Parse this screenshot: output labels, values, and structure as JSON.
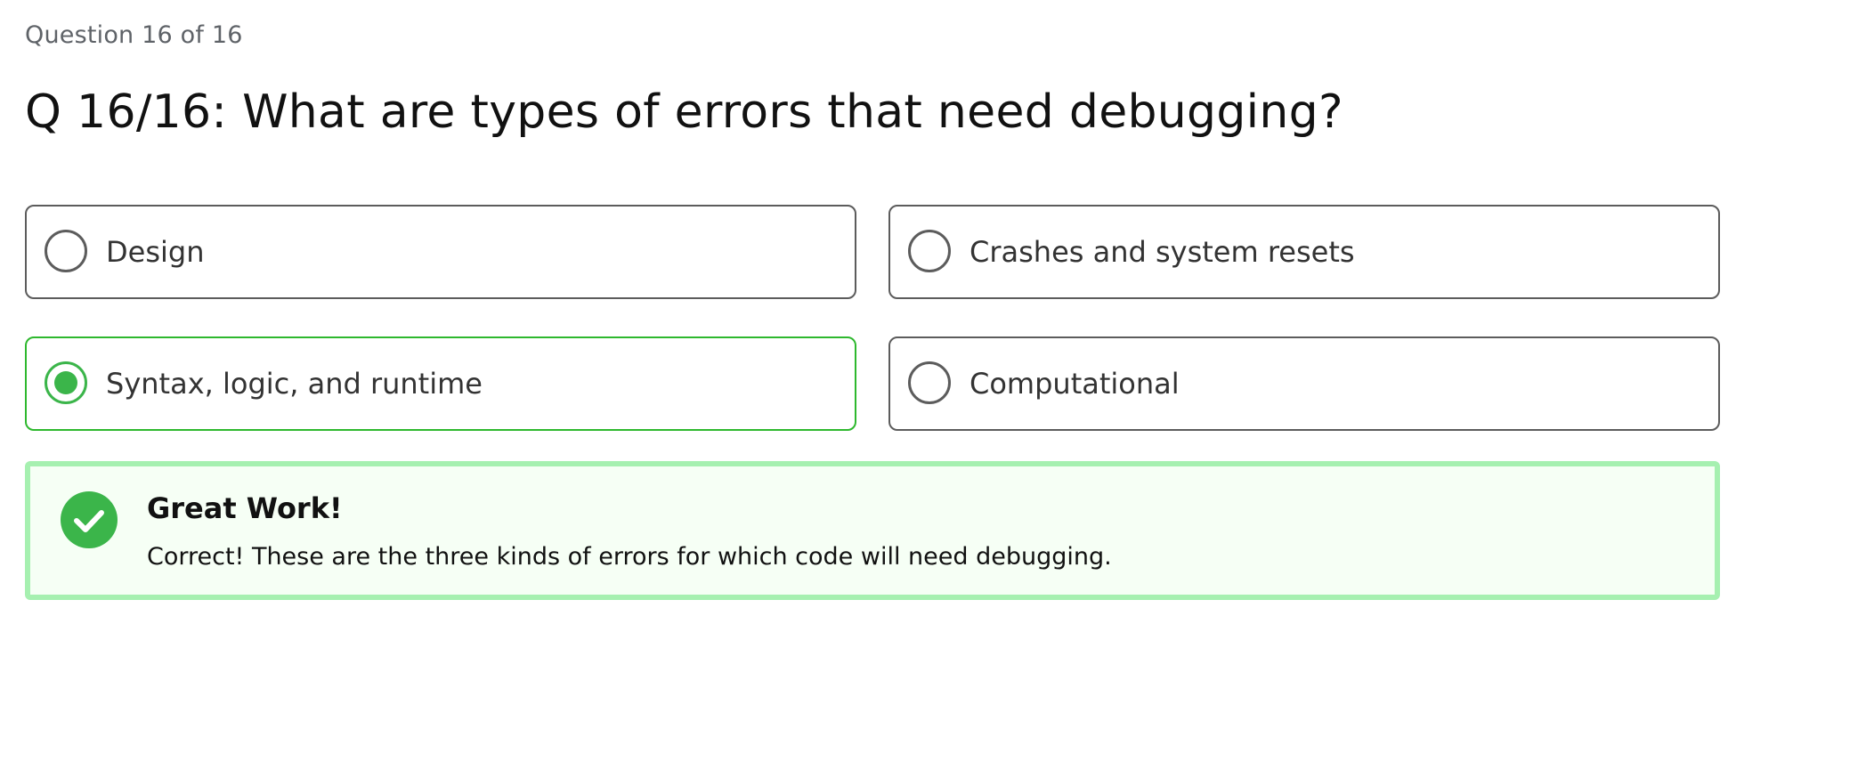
{
  "quiz": {
    "progress_text": "Question 16 of 16",
    "question_text": "Q 16/16: What are types of errors that need debugging?"
  },
  "options": [
    {
      "label": "Design",
      "selected": false
    },
    {
      "label": "Crashes and system resets",
      "selected": false
    },
    {
      "label": "Syntax, logic, and runtime",
      "selected": true
    },
    {
      "label": "Computational",
      "selected": false
    }
  ],
  "feedback": {
    "title": "Great Work!",
    "message": "Correct! These are the three kinds of errors for which code will need debugging.",
    "icon": "check-circle-icon"
  },
  "colors": {
    "accent_green": "#3bb54a",
    "selected_border": "#2eb82e",
    "feedback_border": "#a6f0b0",
    "feedback_background": "#f6fff5",
    "option_border": "#5c5c5c"
  }
}
